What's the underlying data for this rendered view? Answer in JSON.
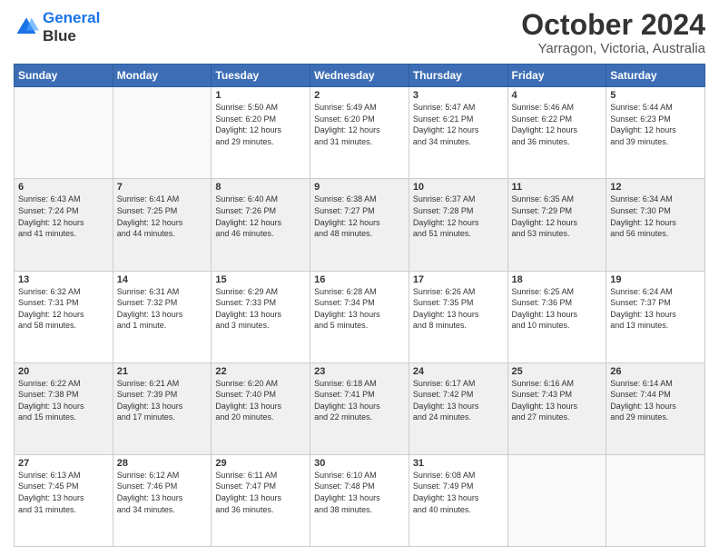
{
  "logo": {
    "line1": "General",
    "line2": "Blue"
  },
  "title": "October 2024",
  "subtitle": "Yarragon, Victoria, Australia",
  "headers": [
    "Sunday",
    "Monday",
    "Tuesday",
    "Wednesday",
    "Thursday",
    "Friday",
    "Saturday"
  ],
  "rows": [
    [
      {
        "day": "",
        "info": ""
      },
      {
        "day": "",
        "info": ""
      },
      {
        "day": "1",
        "info": "Sunrise: 5:50 AM\nSunset: 6:20 PM\nDaylight: 12 hours\nand 29 minutes."
      },
      {
        "day": "2",
        "info": "Sunrise: 5:49 AM\nSunset: 6:20 PM\nDaylight: 12 hours\nand 31 minutes."
      },
      {
        "day": "3",
        "info": "Sunrise: 5:47 AM\nSunset: 6:21 PM\nDaylight: 12 hours\nand 34 minutes."
      },
      {
        "day": "4",
        "info": "Sunrise: 5:46 AM\nSunset: 6:22 PM\nDaylight: 12 hours\nand 36 minutes."
      },
      {
        "day": "5",
        "info": "Sunrise: 5:44 AM\nSunset: 6:23 PM\nDaylight: 12 hours\nand 39 minutes."
      }
    ],
    [
      {
        "day": "6",
        "info": "Sunrise: 6:43 AM\nSunset: 7:24 PM\nDaylight: 12 hours\nand 41 minutes."
      },
      {
        "day": "7",
        "info": "Sunrise: 6:41 AM\nSunset: 7:25 PM\nDaylight: 12 hours\nand 44 minutes."
      },
      {
        "day": "8",
        "info": "Sunrise: 6:40 AM\nSunset: 7:26 PM\nDaylight: 12 hours\nand 46 minutes."
      },
      {
        "day": "9",
        "info": "Sunrise: 6:38 AM\nSunset: 7:27 PM\nDaylight: 12 hours\nand 48 minutes."
      },
      {
        "day": "10",
        "info": "Sunrise: 6:37 AM\nSunset: 7:28 PM\nDaylight: 12 hours\nand 51 minutes."
      },
      {
        "day": "11",
        "info": "Sunrise: 6:35 AM\nSunset: 7:29 PM\nDaylight: 12 hours\nand 53 minutes."
      },
      {
        "day": "12",
        "info": "Sunrise: 6:34 AM\nSunset: 7:30 PM\nDaylight: 12 hours\nand 56 minutes."
      }
    ],
    [
      {
        "day": "13",
        "info": "Sunrise: 6:32 AM\nSunset: 7:31 PM\nDaylight: 12 hours\nand 58 minutes."
      },
      {
        "day": "14",
        "info": "Sunrise: 6:31 AM\nSunset: 7:32 PM\nDaylight: 13 hours\nand 1 minute."
      },
      {
        "day": "15",
        "info": "Sunrise: 6:29 AM\nSunset: 7:33 PM\nDaylight: 13 hours\nand 3 minutes."
      },
      {
        "day": "16",
        "info": "Sunrise: 6:28 AM\nSunset: 7:34 PM\nDaylight: 13 hours\nand 5 minutes."
      },
      {
        "day": "17",
        "info": "Sunrise: 6:26 AM\nSunset: 7:35 PM\nDaylight: 13 hours\nand 8 minutes."
      },
      {
        "day": "18",
        "info": "Sunrise: 6:25 AM\nSunset: 7:36 PM\nDaylight: 13 hours\nand 10 minutes."
      },
      {
        "day": "19",
        "info": "Sunrise: 6:24 AM\nSunset: 7:37 PM\nDaylight: 13 hours\nand 13 minutes."
      }
    ],
    [
      {
        "day": "20",
        "info": "Sunrise: 6:22 AM\nSunset: 7:38 PM\nDaylight: 13 hours\nand 15 minutes."
      },
      {
        "day": "21",
        "info": "Sunrise: 6:21 AM\nSunset: 7:39 PM\nDaylight: 13 hours\nand 17 minutes."
      },
      {
        "day": "22",
        "info": "Sunrise: 6:20 AM\nSunset: 7:40 PM\nDaylight: 13 hours\nand 20 minutes."
      },
      {
        "day": "23",
        "info": "Sunrise: 6:18 AM\nSunset: 7:41 PM\nDaylight: 13 hours\nand 22 minutes."
      },
      {
        "day": "24",
        "info": "Sunrise: 6:17 AM\nSunset: 7:42 PM\nDaylight: 13 hours\nand 24 minutes."
      },
      {
        "day": "25",
        "info": "Sunrise: 6:16 AM\nSunset: 7:43 PM\nDaylight: 13 hours\nand 27 minutes."
      },
      {
        "day": "26",
        "info": "Sunrise: 6:14 AM\nSunset: 7:44 PM\nDaylight: 13 hours\nand 29 minutes."
      }
    ],
    [
      {
        "day": "27",
        "info": "Sunrise: 6:13 AM\nSunset: 7:45 PM\nDaylight: 13 hours\nand 31 minutes."
      },
      {
        "day": "28",
        "info": "Sunrise: 6:12 AM\nSunset: 7:46 PM\nDaylight: 13 hours\nand 34 minutes."
      },
      {
        "day": "29",
        "info": "Sunrise: 6:11 AM\nSunset: 7:47 PM\nDaylight: 13 hours\nand 36 minutes."
      },
      {
        "day": "30",
        "info": "Sunrise: 6:10 AM\nSunset: 7:48 PM\nDaylight: 13 hours\nand 38 minutes."
      },
      {
        "day": "31",
        "info": "Sunrise: 6:08 AM\nSunset: 7:49 PM\nDaylight: 13 hours\nand 40 minutes."
      },
      {
        "day": "",
        "info": ""
      },
      {
        "day": "",
        "info": ""
      }
    ]
  ]
}
